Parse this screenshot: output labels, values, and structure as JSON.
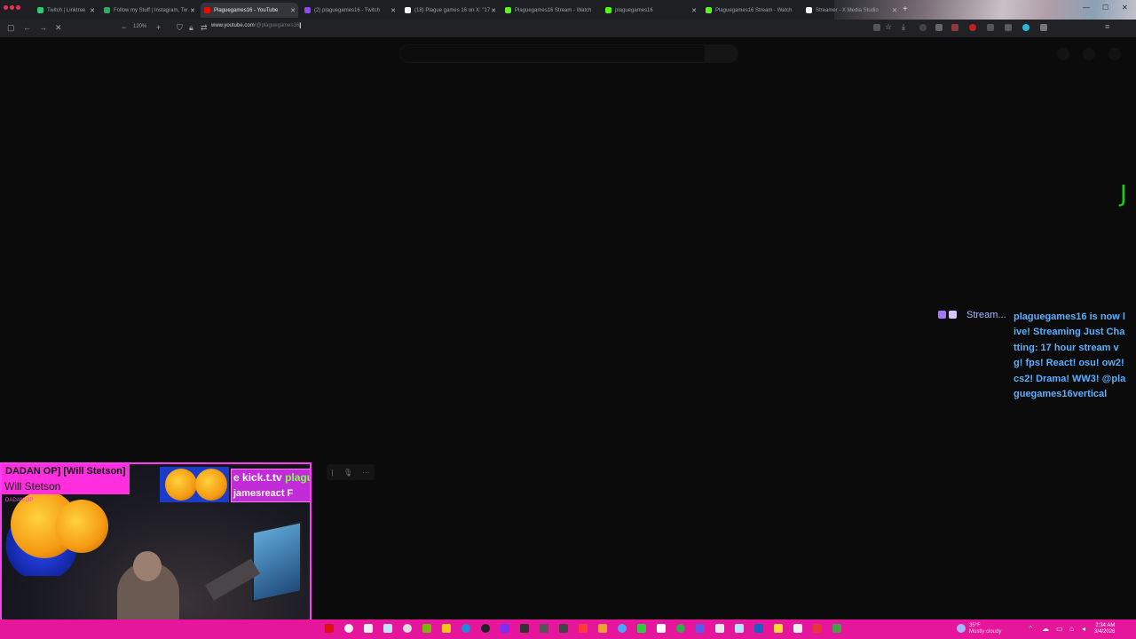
{
  "browser": {
    "tabs": [
      {
        "title": "Twitch | Linktree",
        "favicon_color": "#2ecc71",
        "active": false
      },
      {
        "title": "Follow my Stuff | Instagram, Tw",
        "favicon_color": "#27ae60",
        "active": false
      },
      {
        "title": "Plaguegames16 - YouTube",
        "favicon_color": "#ff0000",
        "active": true
      },
      {
        "title": "(2) plaguegames16 - Twitch",
        "favicon_color": "#9146ff",
        "active": false
      },
      {
        "title": "(18) Plague games 16 on X: \"17",
        "favicon_color": "#ffffff",
        "active": false
      },
      {
        "title": "Plaguegames16 Stream - Watch",
        "favicon_color": "#53fc18",
        "active": false
      },
      {
        "title": "plaguegames16",
        "favicon_color": "#53fc18",
        "active": false
      },
      {
        "title": "Plaguegames16 Stream - Watch",
        "favicon_color": "#53fc18",
        "active": false
      },
      {
        "title": "Streamer - X Media Studio",
        "favicon_color": "#ffffff",
        "active": false
      }
    ],
    "new_tab_label": "+",
    "zoom": "120%",
    "url_host": "www.youtube.com",
    "url_path": "/@plaguegames16"
  },
  "page": {
    "glyph": "J"
  },
  "stream_alert": {
    "label": "Stream...",
    "message": "plaguegames16 is now live! Streaming Just Chatting: 17 hour stream vg! fps! React! osu! ow2! cs2! Drama! WW3! @plaguegames16vertical"
  },
  "webcam": {
    "name_line1": "DADAN OP]  [Will Stetson]",
    "name_line2": "Will Stetson",
    "kick_prefix": "e",
    "kick_text": "kick.t.tv",
    "kick_suffix": "plagu",
    "kick_line2": "jamesreact F",
    "small_text": "DADAN OP"
  },
  "taskbar": {
    "weather_temp": "35°F",
    "weather_desc": "Mostly cloudy",
    "time": "2:34 AM",
    "date": "3/4/2026"
  },
  "colors": {
    "accent_magenta": "#ff2fe0",
    "taskbar": "#e5169b",
    "alert_text": "#5ab0ff",
    "glyph_green": "#15d10a"
  }
}
